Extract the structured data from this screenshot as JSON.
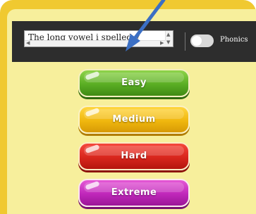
{
  "topic": {
    "text": "The long vowel i spelled y"
  },
  "phonics_toggle": {
    "label": "Phonics",
    "state": "off"
  },
  "levels": [
    {
      "label": "Easy",
      "color": "#5aae24"
    },
    {
      "label": "Medium",
      "color": "#f0b70e"
    },
    {
      "label": "Hard",
      "color": "#d8261d"
    },
    {
      "label": "Extreme",
      "color": "#bf27ba"
    }
  ],
  "colors": {
    "frame": "#f0c930",
    "panel": "#f7ef9c",
    "toolbar": "#2d2d2d",
    "annotation_arrow": "#3b6fc4"
  },
  "annotation": {
    "icon": "arrow-down-left-icon"
  }
}
